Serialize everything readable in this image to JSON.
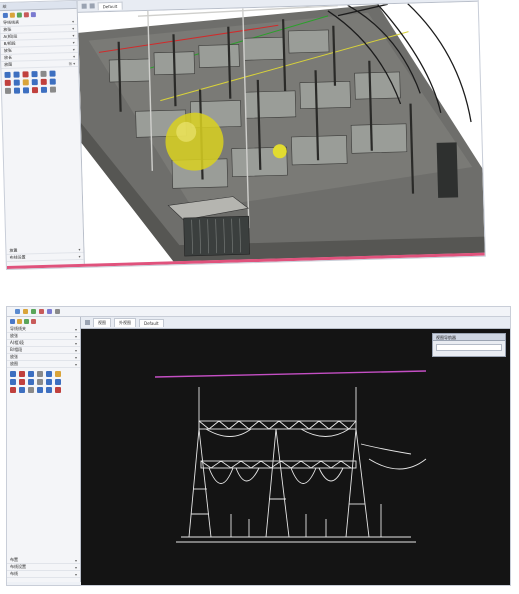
{
  "shot_a": {
    "panel_title": "绘",
    "panel_rows": [
      {
        "label": "导线线夹",
        "mark": "▾"
      },
      {
        "label": "放张",
        "mark": "▾"
      },
      {
        "label": "A(相)段",
        "mark": "▾"
      },
      {
        "label": "B/相段",
        "mark": "▾"
      },
      {
        "label": "放张",
        "mark": "▾"
      },
      {
        "label": "放长",
        "mark": "▾"
      },
      {
        "label": "放图",
        "mark": "⊞ ▾"
      }
    ],
    "panel_bottom_rows": [
      {
        "label": "放置",
        "mark": "▾"
      },
      {
        "label": "布线设置",
        "mark": "▾"
      }
    ],
    "tab_label": "Default"
  },
  "shot_b": {
    "panel_rows": [
      {
        "label": "导线线夹",
        "mark": "▾"
      },
      {
        "label": "放张",
        "mark": "▾"
      },
      {
        "label": "A(相)段",
        "mark": "▾"
      },
      {
        "label": "B/相段",
        "mark": "▾"
      },
      {
        "label": "放张",
        "mark": "▾"
      },
      {
        "label": "放图",
        "mark": "▾"
      }
    ],
    "panel_bottom_rows": [
      {
        "label": "布置",
        "mark": "▾"
      },
      {
        "label": "布线设置",
        "mark": "▾"
      },
      {
        "label": "布线",
        "mark": "▾"
      }
    ],
    "tabs": [
      "视图",
      "外视图",
      "Default"
    ],
    "float_window_title": "视图导航器"
  },
  "colors": {
    "accent_pink": "#e0527c",
    "magenta_line": "#c44fc4",
    "viewport_dark": "#141414",
    "highlight_sphere": "#d9d120"
  },
  "icons": [
    "pencil-icon",
    "line-icon",
    "arc-icon",
    "circle-icon",
    "text-icon",
    "dimension-icon"
  ]
}
